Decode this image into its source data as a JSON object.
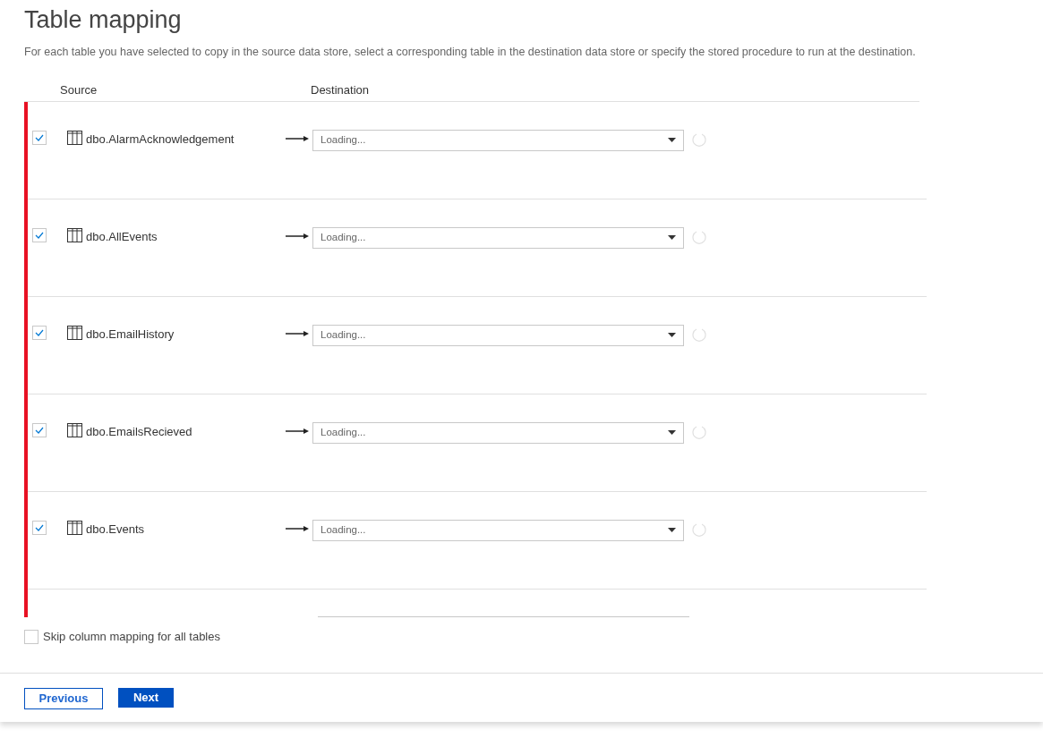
{
  "title": "Table mapping",
  "description": "For each table you have selected to copy in the source data store, select a corresponding table in the destination data store or specify the stored procedure to run at the destination.",
  "columns": [
    "Source",
    "Destination"
  ],
  "rows": [
    {
      "checked": true,
      "source": "dbo.AlarmAcknowledgement",
      "destination": "Loading..."
    },
    {
      "checked": true,
      "source": "dbo.AllEvents",
      "destination": "Loading..."
    },
    {
      "checked": true,
      "source": "dbo.EmailHistory",
      "destination": "Loading..."
    },
    {
      "checked": true,
      "source": "dbo.EmailsRecieved",
      "destination": "Loading..."
    },
    {
      "checked": true,
      "source": "dbo.Events",
      "destination": "Loading..."
    }
  ],
  "skip_column_mapping": {
    "label": "Skip column mapping for all tables",
    "checked": false
  },
  "buttons": {
    "previous": "Previous",
    "next": "Next"
  }
}
